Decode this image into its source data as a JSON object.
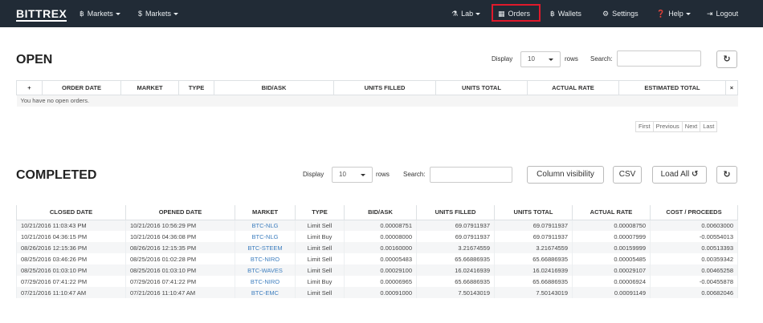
{
  "navbar": {
    "brand": "BITTREX",
    "btc_markets": "Markets",
    "usd_markets": "Markets",
    "lab": "Lab",
    "orders": "Orders",
    "wallets": "Wallets",
    "settings": "Settings",
    "help": "Help",
    "logout": "Logout"
  },
  "open": {
    "title": "OPEN",
    "display_label": "Display",
    "rows_value": "10",
    "rows_label": "rows",
    "search_label": "Search:",
    "columns": [
      "+",
      "ORDER DATE",
      "MARKET",
      "TYPE",
      "BID/ASK",
      "UNITS FILLED",
      "UNITS TOTAL",
      "ACTUAL RATE",
      "ESTIMATED TOTAL",
      "×"
    ],
    "empty_message": "You have no open orders.",
    "pager": [
      "First",
      "Previous",
      "Next",
      "Last"
    ]
  },
  "completed": {
    "title": "COMPLETED",
    "display_label": "Display",
    "rows_value": "10",
    "rows_label": "rows",
    "search_label": "Search:",
    "column_visibility": "Column visibility",
    "csv": "CSV",
    "load_all": "Load All",
    "columns": [
      "CLOSED DATE",
      "OPENED DATE",
      "MARKET",
      "TYPE",
      "BID/ASK",
      "UNITS FILLED",
      "UNITS TOTAL",
      "ACTUAL RATE",
      "COST / PROCEEDS"
    ],
    "rows": [
      [
        "10/21/2016 11:03:43 PM",
        "10/21/2016 10:56:29 PM",
        "BTC-NLG",
        "Limit Sell",
        "0.00008751",
        "69.07911937",
        "69.07911937",
        "0.00008750",
        "0.00603000"
      ],
      [
        "10/21/2016 04:36:15 PM",
        "10/21/2016 04:36:08 PM",
        "BTC-NLG",
        "Limit Buy",
        "0.00008000",
        "69.07911937",
        "69.07911937",
        "0.00007999",
        "-0.00554013"
      ],
      [
        "08/26/2016 12:15:36 PM",
        "08/26/2016 12:15:35 PM",
        "BTC-STEEM",
        "Limit Sell",
        "0.00160000",
        "3.21674559",
        "3.21674559",
        "0.00159999",
        "0.00513393"
      ],
      [
        "08/25/2016 03:46:26 PM",
        "08/25/2016 01:02:28 PM",
        "BTC-NIRO",
        "Limit Sell",
        "0.00005483",
        "65.66886935",
        "65.66886935",
        "0.00005485",
        "0.00359342"
      ],
      [
        "08/25/2016 01:03:10 PM",
        "08/25/2016 01:03:10 PM",
        "BTC-WAVES",
        "Limit Sell",
        "0.00029100",
        "16.02416939",
        "16.02416939",
        "0.00029107",
        "0.00465258"
      ],
      [
        "07/29/2016 07:41:22 PM",
        "07/29/2016 07:41:22 PM",
        "BTC-NIRO",
        "Limit Buy",
        "0.00006965",
        "65.66886935",
        "65.66886935",
        "0.00006924",
        "-0.00455878"
      ],
      [
        "07/21/2016 11:10:47 AM",
        "07/21/2016 11:10:47 AM",
        "BTC-EMC",
        "Limit Sell",
        "0.00091000",
        "7.50143019",
        "7.50143019",
        "0.00091149",
        "0.00682046"
      ]
    ]
  },
  "colors": {
    "navbar_bg": "#212b36",
    "highlight": "#e0192b",
    "link": "#3f7fbf"
  }
}
